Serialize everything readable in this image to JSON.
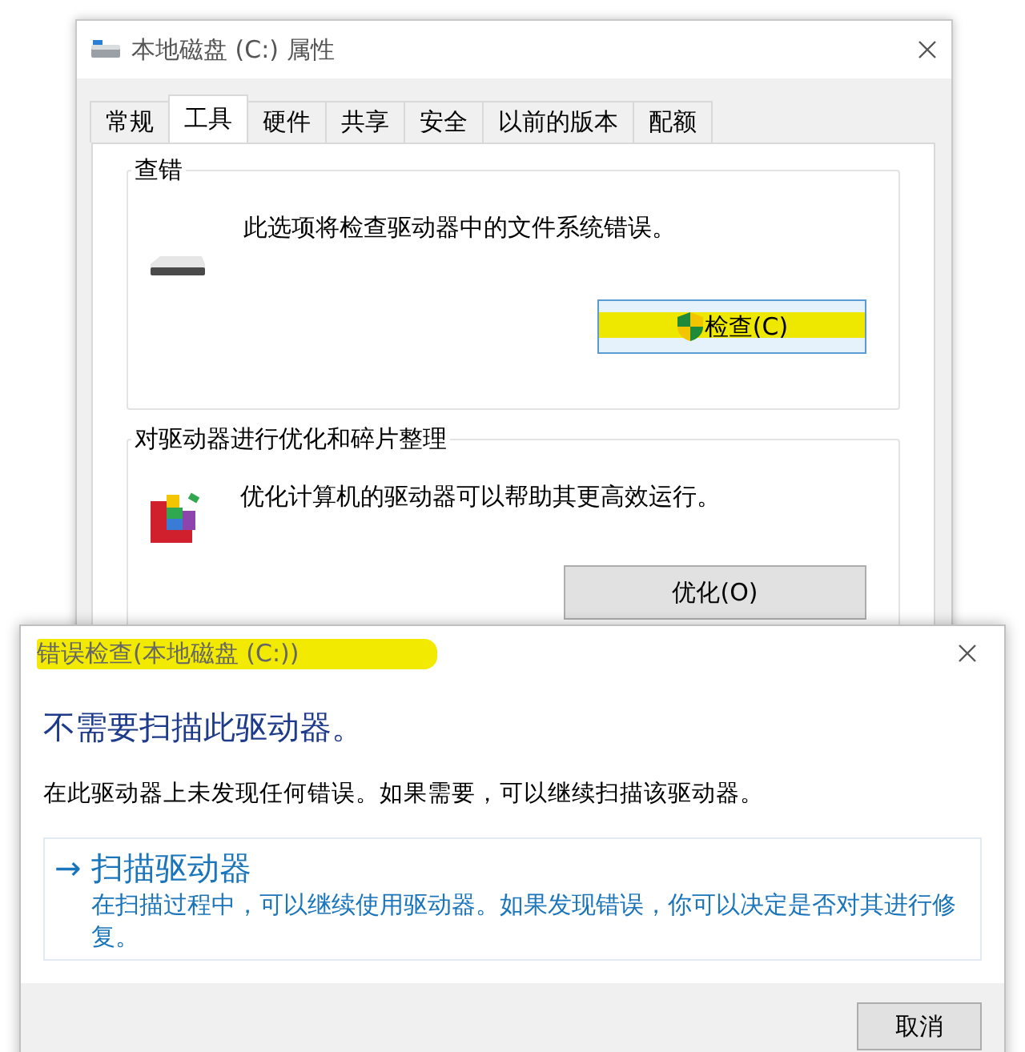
{
  "properties_window": {
    "title": "本地磁盘 (C:) 属性",
    "tabs": [
      {
        "label": "常规",
        "selected": false
      },
      {
        "label": "工具",
        "selected": true
      },
      {
        "label": "硬件",
        "selected": false
      },
      {
        "label": "共享",
        "selected": false
      },
      {
        "label": "安全",
        "selected": false
      },
      {
        "label": "以前的版本",
        "selected": false
      },
      {
        "label": "配额",
        "selected": false
      }
    ],
    "sections": [
      {
        "kind": "drive",
        "heading": "查错",
        "description": "此选项将检查驱动器中的文件系统错误。",
        "button": {
          "label": "检查(C)",
          "shield": true,
          "highlighted": true
        }
      },
      {
        "kind": "defrag",
        "heading": "对驱动器进行优化和碎片整理",
        "description": "优化计算机的驱动器可以帮助其更高效运行。",
        "button": {
          "label": "优化(O)",
          "shield": false,
          "highlighted": false
        }
      }
    ]
  },
  "error_check_dialog": {
    "title": "错误检查(本地磁盘 (C:))",
    "title_highlighted": true,
    "heading": "不需要扫描此驱动器。",
    "message": "在此驱动器上未发现任何错误。如果需要，可以继续扫描该驱动器。",
    "action": {
      "arrow": "→",
      "title": "扫描驱动器",
      "description": "在扫描过程中，可以继续使用驱动器。如果发现错误，你可以决定是否对其进行修复。"
    },
    "buttons": [
      "取消"
    ]
  }
}
